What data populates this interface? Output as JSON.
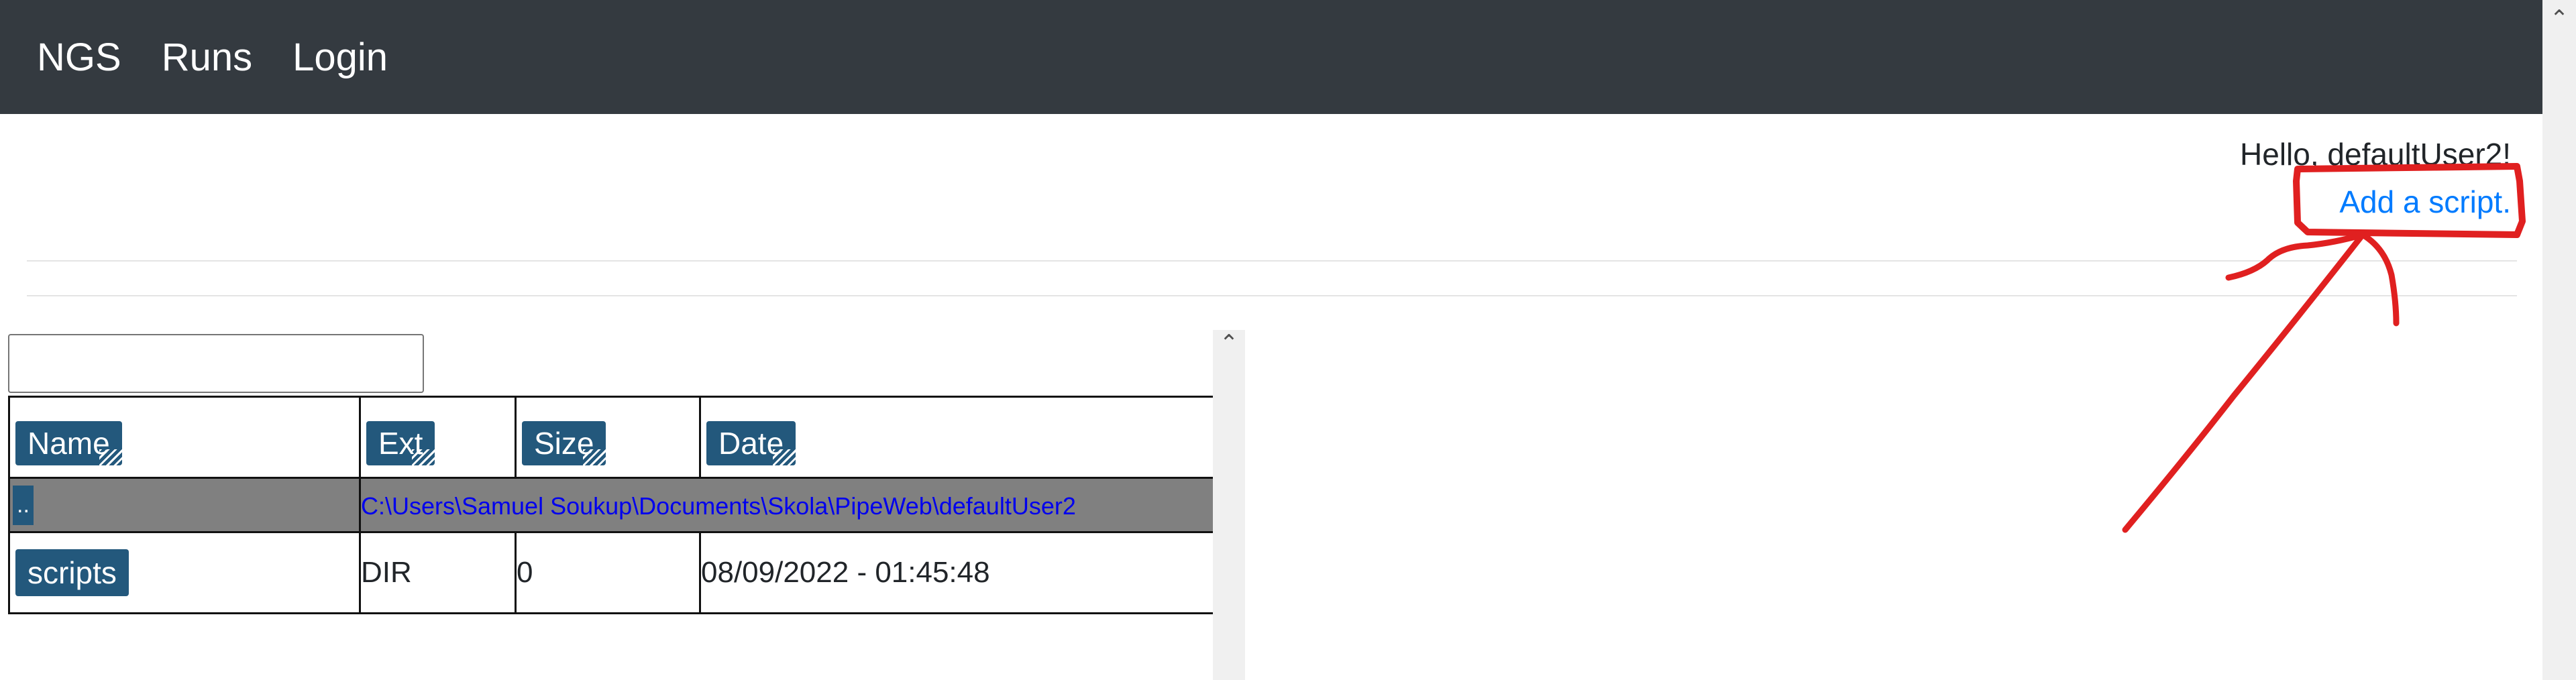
{
  "navbar": {
    "brand": "NGS",
    "runs": "Runs",
    "login": "Login"
  },
  "greeting": "Hello, defaultUser2!",
  "add_script_link": "Add a script.",
  "search": {
    "value": "",
    "placeholder": ""
  },
  "table": {
    "headers": {
      "name": "Name",
      "ext": "Ext",
      "size": "Size",
      "date": "Date"
    },
    "parent_row": {
      "up_label": "..",
      "path": "C:\\Users\\Samuel Soukup\\Documents\\Skola\\PipeWeb\\defaultUser2"
    },
    "rows": [
      {
        "name": "scripts",
        "ext": "DIR",
        "size": "0",
        "date": "08/09/2022 - 01:45:48"
      }
    ]
  },
  "colors": {
    "navbar": "#343a40",
    "link": "#007bff",
    "button": "#23587c",
    "parent_row": "#808080",
    "annotation": "#e02020"
  },
  "icons": {
    "scroll_up": "chevron-up-icon",
    "resize_grip": "resize-grip-icon"
  }
}
